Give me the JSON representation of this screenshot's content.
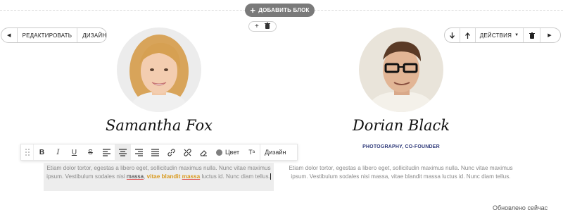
{
  "add_block": {
    "label": "ДОБАВИТЬ БЛОК"
  },
  "left_toolbar": {
    "edit_label": "РЕДАКТИРОВАТЬ",
    "design_label": "ДИЗАЙН"
  },
  "right_toolbar": {
    "actions_label": "ДЕЙСТВИЯ"
  },
  "members": [
    {
      "name": "Samantha Fox"
    },
    {
      "name": "Dorian Black",
      "role": "PHOTOGRAPHY, CO-FOUNDER"
    }
  ],
  "format_toolbar": {
    "color_label": "Цвет",
    "design_label": "Дизайн"
  },
  "left_description": {
    "part1": "Etiam dolor tortor, egestas a libero eget, sollicitudin maximus nulla. Nunc vitae maximus ipsum. Vestibulum sodales nisi ",
    "hl1": "massa",
    "mid": ", ",
    "hl2": "vitae blandit",
    "space": " ",
    "hl3": "massa",
    "part2": " luctus id. Nunc diam tellus."
  },
  "right_description": "Etiam dolor tortor, egestas a libero eget, sollicitudin maximus nulla. Nunc vitae maximus ipsum. Vestibulum sodales nisi massa, vitae blandit massa luctus id. Nunc diam tellus.",
  "status": "Обновлено сейчас",
  "colors": {
    "accent_role": "#2f3a7a",
    "highlight": "#d99a1e",
    "pill_bg": "#7a7a7a"
  }
}
